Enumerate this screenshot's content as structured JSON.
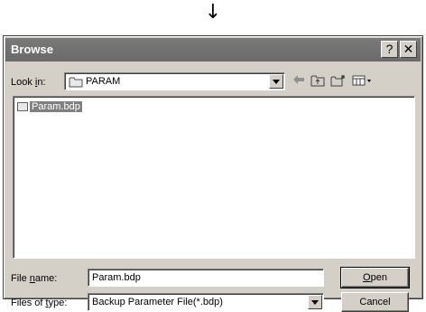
{
  "arrow": "↓",
  "window": {
    "title": "Browse",
    "help_glyph": "?",
    "close_glyph": "✕"
  },
  "lookin": {
    "label_pre": "Look ",
    "label_key": "i",
    "label_post": "n:",
    "value": "PARAM",
    "icon": "folder-icon"
  },
  "toolbar": {
    "back_icon": "back-arrow-icon",
    "up_icon": "up-folder-icon",
    "newfolder_icon": "new-folder-icon",
    "view_icon": "view-menu-icon"
  },
  "files": [
    {
      "name": "Param.bdp",
      "selected": true,
      "icon": "file-icon"
    }
  ],
  "filename": {
    "label_pre": "File ",
    "label_key": "n",
    "label_post": "ame:",
    "value": "Param.bdp"
  },
  "filetype": {
    "label_pre": "Files of ",
    "label_key": "t",
    "label_post": "ype:",
    "value": "Backup Parameter File(*.bdp)"
  },
  "buttons": {
    "open_key": "O",
    "open_rest": "pen",
    "cancel": "Cancel"
  }
}
